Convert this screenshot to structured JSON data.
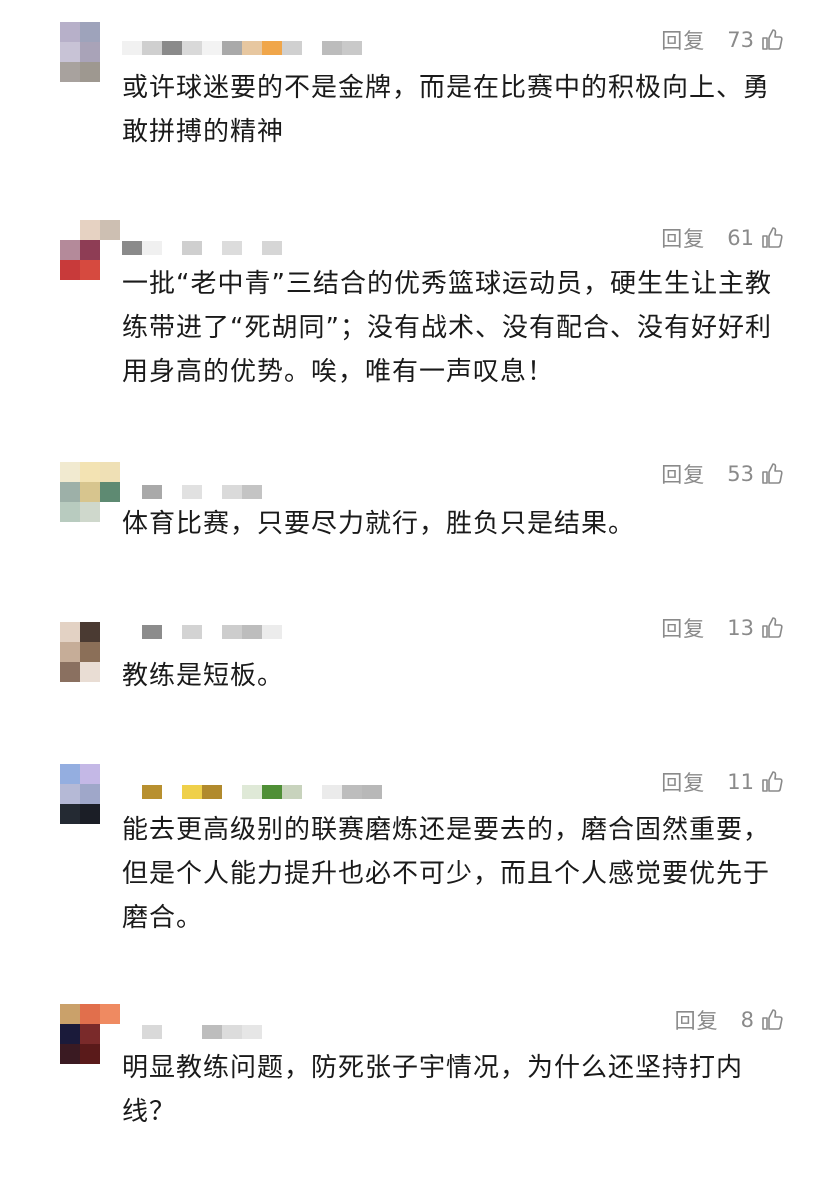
{
  "comments": [
    {
      "reply": "回复",
      "likes": "73",
      "text": "或许球迷要的不是金牌，而是在比赛中的积极向上、勇敢拼搏的精神",
      "avatar": [
        "#b7b0c9",
        "#9ea3bb",
        "#ffffff",
        "#c8c3d6",
        "#a9a3b8",
        "#ffffff",
        "#a8a29e",
        "#9e9890",
        "#ffffff"
      ],
      "name": [
        "#f1f1f1",
        "#cfcfcf",
        "#8a8a8a",
        "#d9d9d9",
        "#f3f3f3",
        "#a9a9a9",
        "#e7c7a0",
        "#f0a64a",
        "#d0d0d0",
        "#ffffff",
        "#bcbcbc",
        "#c9c9c9"
      ]
    },
    {
      "reply": "回复",
      "likes": "61",
      "text": "一批“老中青”三结合的优秀篮球运动员，硬生生让主教练带进了“死胡同”；没有战术、没有配合、没有好好利用身高的优势。唉，唯有一声叹息！",
      "avatar": [
        "#ffffff",
        "#e6d2c2",
        "#cdbfb2",
        "#b48a9a",
        "#8e3d55",
        "#ffffff",
        "#c83a3a",
        "#d64a3f",
        "#ffffff"
      ],
      "name": [
        "#8a8a8a",
        "#f0f0f0",
        "#ffffff",
        "#cfcfcf",
        "#ffffff",
        "#dcdcdc",
        "#ffffff",
        "#d6d6d6",
        "#ffffff",
        "#ffffff"
      ]
    },
    {
      "reply": "回复",
      "likes": "53",
      "text": "体育比赛，只要尽力就行，胜负只是结果。",
      "avatar": [
        "#f1ead0",
        "#f3e3b3",
        "#efe0b5",
        "#9db0a8",
        "#d7c58e",
        "#5e8a72",
        "#b8cbbf",
        "#cfd8cc",
        "#ffffff"
      ],
      "name": [
        "#ffffff",
        "#a9a9a9",
        "#ffffff",
        "#e1e1e1",
        "#ffffff",
        "#dadada",
        "#c4c4c4",
        "#ffffff"
      ]
    },
    {
      "reply": "回复",
      "likes": "13",
      "text": "教练是短板。",
      "avatar": [
        "#e3d2c4",
        "#4a3a32",
        "#ffffff",
        "#c6ad98",
        "#8b6f58",
        "#ffffff",
        "#8a7060",
        "#e9ddd4",
        "#ffffff"
      ],
      "name": [
        "#ffffff",
        "#8c8c8c",
        "#ffffff",
        "#d3d3d3",
        "#ffffff",
        "#cdcdcd",
        "#bdbdbd",
        "#ececec"
      ]
    },
    {
      "reply": "回复",
      "likes": "11",
      "text": "能去更高级别的联赛磨炼还是要去的，磨合固然重要，但是个人能力提升也必不可少，而且个人感觉要优先于磨合。",
      "avatar": [
        "#94aee0",
        "#c4b8e6",
        "#ffffff",
        "#b5b9d6",
        "#9fa7c9",
        "#ffffff",
        "#242a33",
        "#1b1e26",
        "#ffffff"
      ],
      "name": [
        "#ffffff",
        "#b8902f",
        "#ffffff",
        "#efd04a",
        "#b18a2d",
        "#ffffff",
        "#dfe9d7",
        "#4f8f36",
        "#c8d3bd",
        "#ffffff",
        "#ebebeb",
        "#bdbdbd",
        "#b8b8b8"
      ]
    },
    {
      "reply": "回复",
      "likes": "8",
      "text": "明显教练问题，防死张子宇情况，为什么还坚持打内线？",
      "avatar": [
        "#caa16a",
        "#e16f4c",
        "#ef8a61",
        "#1a1a3a",
        "#7a2a2a",
        "#ffffff",
        "#3a1a22",
        "#5a1a1a",
        "#ffffff"
      ],
      "name": [
        "#ffffff",
        "#d9d9d9",
        "#ffffff",
        "#ffffff",
        "#bdbdbd",
        "#dcdcdc",
        "#e6e6e6"
      ]
    }
  ]
}
